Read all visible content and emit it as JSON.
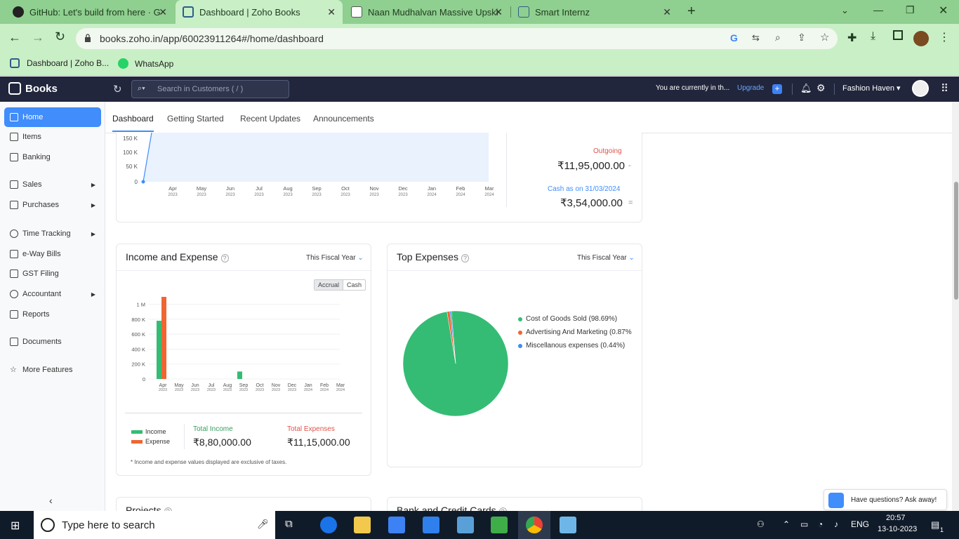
{
  "browser": {
    "tabs": [
      {
        "title": "GitHub: Let's build from here · G"
      },
      {
        "title": "Dashboard | Zoho Books"
      },
      {
        "title": "Naan Mudhalvan Massive Upski"
      },
      {
        "title": "Smart Internz"
      }
    ],
    "url": "books.zoho.in/app/60023911264#/home/dashboard",
    "bookmarks": [
      {
        "label": "Dashboard | Zoho B..."
      },
      {
        "label": "WhatsApp"
      }
    ]
  },
  "app": {
    "brand": "Books",
    "search_placeholder": "Search in Customers ( / )",
    "trial_text": "You are currently in th...",
    "upgrade_label": "Upgrade",
    "org_name": "Fashion Haven"
  },
  "sidebar": {
    "items": [
      {
        "label": "Home",
        "icon": "home-icon",
        "active": true
      },
      {
        "label": "Items",
        "icon": "items-icon"
      },
      {
        "label": "Banking",
        "icon": "bank-icon"
      },
      {
        "label": "Sales",
        "icon": "cart-icon",
        "arrow": true
      },
      {
        "label": "Purchases",
        "icon": "bag-icon",
        "arrow": true
      },
      {
        "label": "Time Tracking",
        "icon": "clock-icon",
        "arrow": true
      },
      {
        "label": "e-Way Bills",
        "icon": "truck-icon"
      },
      {
        "label": "GST Filing",
        "icon": "gst-icon"
      },
      {
        "label": "Accountant",
        "icon": "accountant-icon",
        "arrow": true
      },
      {
        "label": "Reports",
        "icon": "reports-icon"
      },
      {
        "label": "Documents",
        "icon": "folder-icon"
      },
      {
        "label": "More Features",
        "icon": "star-icon"
      }
    ]
  },
  "dashboard_tabs": [
    "Dashboard",
    "Getting Started",
    "Recent Updates",
    "Announcements"
  ],
  "cashflow": {
    "y_ticks": [
      "150 K",
      "100 K",
      "50 K",
      "0"
    ],
    "months": [
      [
        "Apr",
        "2023"
      ],
      [
        "May",
        "2023"
      ],
      [
        "Jun",
        "2023"
      ],
      [
        "Jul",
        "2023"
      ],
      [
        "Aug",
        "2023"
      ],
      [
        "Sep",
        "2023"
      ],
      [
        "Oct",
        "2023"
      ],
      [
        "Nov",
        "2023"
      ],
      [
        "Dec",
        "2023"
      ],
      [
        "Jan",
        "2024"
      ],
      [
        "Feb",
        "2024"
      ],
      [
        "Mar",
        "2024"
      ]
    ],
    "outgoing_label": "Outgoing",
    "outgoing_value": "₹11,95,000.00",
    "outgoing_sign": "-",
    "cash_label": "Cash as on 31/03/2024",
    "cash_value": "₹3,54,000.00",
    "cash_sign": "="
  },
  "income_expense": {
    "title": "Income and Expense",
    "period": "This Fiscal Year",
    "toggle": [
      "Accrual",
      "Cash"
    ],
    "legend": [
      "Income",
      "Expense"
    ],
    "total_income_label": "Total Income",
    "total_income_value": "₹8,80,000.00",
    "total_expense_label": "Total Expenses",
    "total_expense_value": "₹11,15,000.00",
    "footnote": "* Income and expense values displayed are exclusive of taxes."
  },
  "top_expenses": {
    "title": "Top Expenses",
    "period": "This Fiscal Year",
    "legend": [
      {
        "label": "Cost of Goods Sold (98.69%)",
        "color": "#34bc74"
      },
      {
        "label": "Advertising And Marketing (0.87%",
        "color": "#f06532"
      },
      {
        "label": "Miscellanous expenses (0.44%)",
        "color": "#3f8cf0"
      }
    ]
  },
  "lower_cards": {
    "projects": "Projects",
    "bank": "Bank and Credit Cards"
  },
  "help": {
    "text": "Have questions? Ask away!"
  },
  "taskbar": {
    "search": "Type here to search",
    "lang": "ENG",
    "time": "20:57",
    "date": "13-10-2023",
    "notif_count": "1"
  },
  "chart_data": [
    {
      "type": "line",
      "title": "",
      "categories": [
        "Apr 2023",
        "May 2023",
        "Jun 2023",
        "Jul 2023",
        "Aug 2023",
        "Sep 2023",
        "Oct 2023",
        "Nov 2023",
        "Dec 2023",
        "Jan 2024",
        "Feb 2024",
        "Mar 2024"
      ],
      "y_ticks": [
        0,
        50000,
        100000,
        150000
      ],
      "note": "cash flow area chart, partially scrolled out of view"
    },
    {
      "type": "bar",
      "title": "Income and Expense",
      "categories": [
        "Apr 2023",
        "May 2023",
        "Jun 2023",
        "Jul 2023",
        "Aug 2023",
        "Sep 2023",
        "Oct 2023",
        "Nov 2023",
        "Dec 2023",
        "Jan 2024",
        "Feb 2024",
        "Mar 2024"
      ],
      "y_ticks": [
        "0",
        "200 K",
        "400 K",
        "600 K",
        "800 K",
        "1 M"
      ],
      "ylim": [
        0,
        1100000
      ],
      "series": [
        {
          "name": "Income",
          "color": "#34bc74",
          "values": [
            780000,
            0,
            0,
            0,
            0,
            100000,
            0,
            0,
            0,
            0,
            0,
            0
          ]
        },
        {
          "name": "Expense",
          "color": "#f06532",
          "values": [
            1115000,
            0,
            0,
            0,
            0,
            0,
            0,
            0,
            0,
            0,
            0,
            0
          ]
        }
      ]
    },
    {
      "type": "pie",
      "title": "Top Expenses",
      "labels": [
        "Cost of Goods Sold",
        "Advertising And Marketing",
        "Miscellanous expenses"
      ],
      "values": [
        98.69,
        0.87,
        0.44
      ],
      "colors": [
        "#34bc74",
        "#f06532",
        "#3f8cf0"
      ]
    }
  ]
}
